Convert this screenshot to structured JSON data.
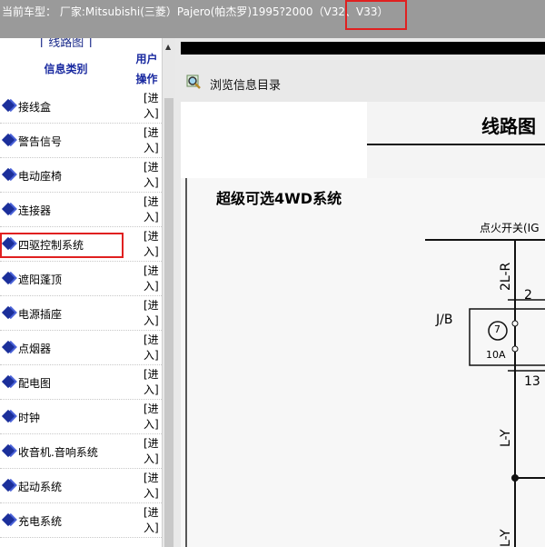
{
  "header": {
    "title": "当前车型： 厂家:Mitsubishi(三菱）Pajero(帕杰罗)1995?2000（V32、V33）"
  },
  "sidebar": {
    "header_partial": "[ 线路图 ]",
    "col_category": "信息类别",
    "col_ops_line1": "用户",
    "col_ops_line2": "操作",
    "enter_line1": "[进",
    "enter_line2": "入]",
    "items": [
      {
        "label": "接线盒"
      },
      {
        "label": "警告信号"
      },
      {
        "label": "电动座椅"
      },
      {
        "label": "连接器"
      },
      {
        "label": "四驱控制系统"
      },
      {
        "label": "遮阳蓬顶"
      },
      {
        "label": "电源插座"
      },
      {
        "label": "点烟器"
      },
      {
        "label": "配电图"
      },
      {
        "label": "时钟"
      },
      {
        "label": "收音机.音响系统"
      },
      {
        "label": "起动系统"
      },
      {
        "label": "充电系统"
      }
    ]
  },
  "main": {
    "browse_label": "浏览信息目录",
    "doc_title_top": "线路图",
    "doc_title": "超级可选4WD系统",
    "ignition": "点火开关(IG",
    "wire_2lr": "2L-R",
    "wire_ly": "L-Y",
    "wire_ly2": "L-Y",
    "jb": "J/B",
    "fuse_no": "7",
    "fuse_amp": "10A",
    "pin2": "2",
    "pin13": "13"
  },
  "colors": {
    "topbar_bg": "#9a9a9a",
    "highlight": "#e02020",
    "category_blue": "#1a2aa0"
  }
}
